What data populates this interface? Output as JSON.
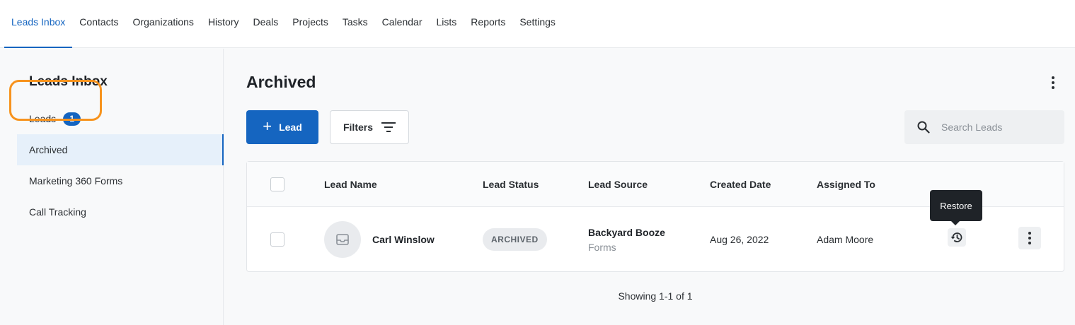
{
  "topnav": {
    "items": [
      {
        "label": "Leads Inbox",
        "active": true
      },
      {
        "label": "Contacts"
      },
      {
        "label": "Organizations"
      },
      {
        "label": "History"
      },
      {
        "label": "Deals"
      },
      {
        "label": "Projects"
      },
      {
        "label": "Tasks"
      },
      {
        "label": "Calendar"
      },
      {
        "label": "Lists"
      },
      {
        "label": "Reports"
      },
      {
        "label": "Settings"
      }
    ]
  },
  "sidebar": {
    "title": "Leads Inbox",
    "items": [
      {
        "label": "Leads",
        "badge": "1"
      },
      {
        "label": "Archived",
        "selected": true
      },
      {
        "label": "Marketing 360 Forms"
      },
      {
        "label": "Call Tracking"
      }
    ]
  },
  "main": {
    "title": "Archived",
    "add_lead_label": "Lead",
    "filters_label": "Filters",
    "search_placeholder": "Search Leads",
    "table": {
      "columns": [
        "Lead Name",
        "Lead Status",
        "Lead Source",
        "Created Date",
        "Assigned To"
      ],
      "rows": [
        {
          "name": "Carl Winslow",
          "status": "ARCHIVED",
          "source": "Backyard Booze",
          "source_sub": "Forms",
          "created": "Aug 26, 2022",
          "assigned": "Adam Moore"
        }
      ]
    },
    "tooltip": "Restore",
    "showing": "Showing 1-1 of 1"
  },
  "colors": {
    "accent": "#1565c0",
    "highlight": "#f7931e"
  }
}
